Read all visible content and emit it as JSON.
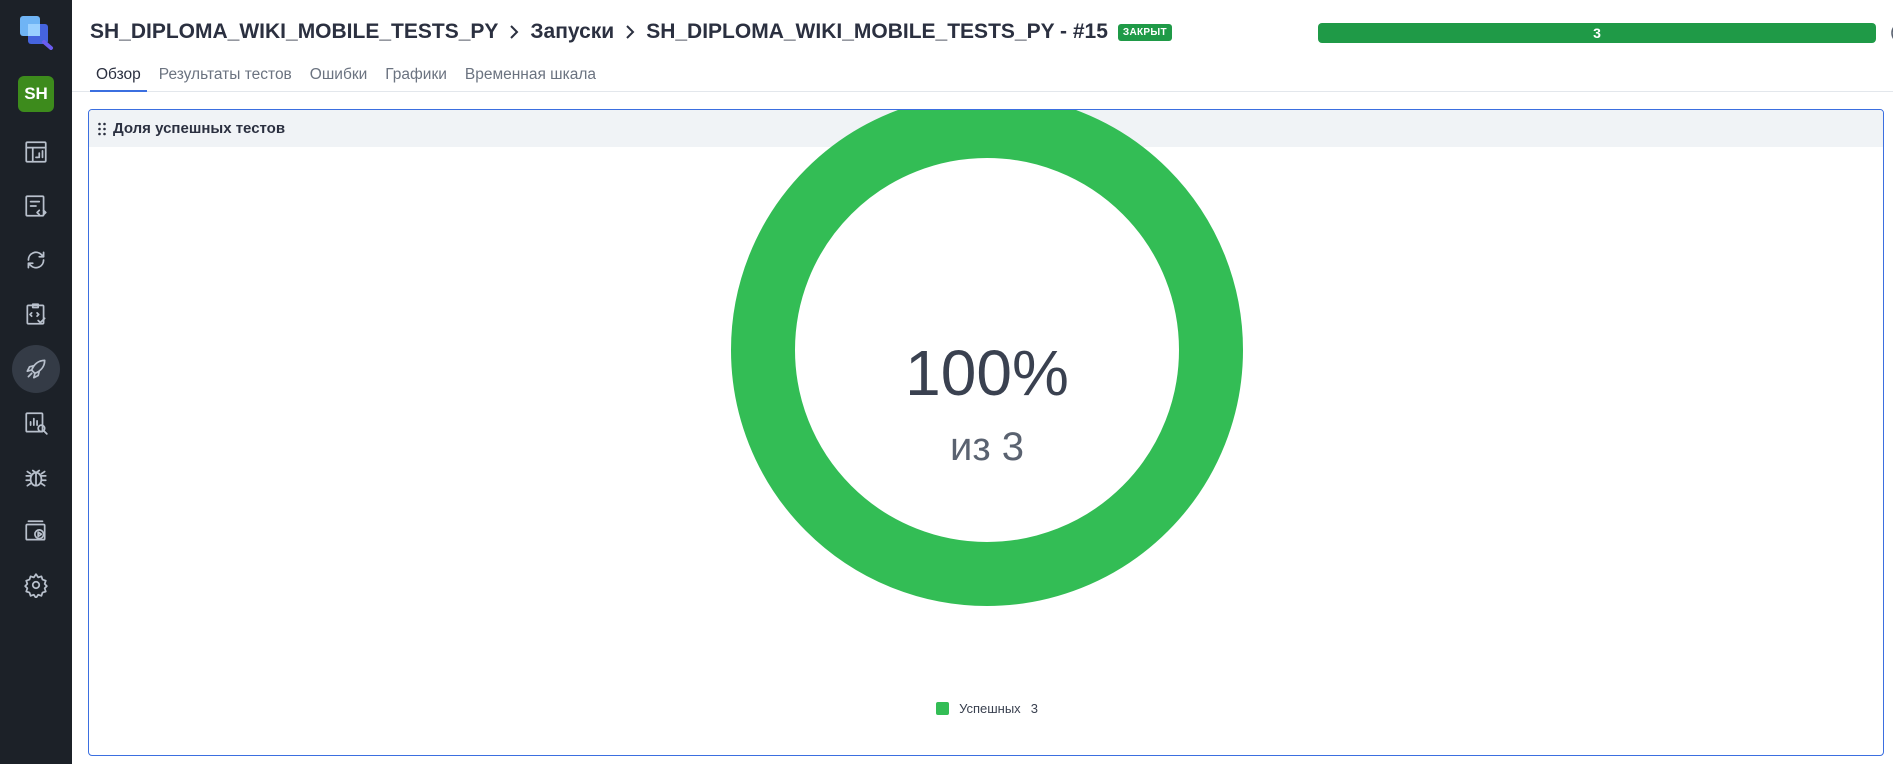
{
  "app": {
    "avatar_initials": "SH"
  },
  "sidebar": {
    "items": [
      {
        "icon": "dashboard-icon"
      },
      {
        "icon": "test-cases-icon"
      },
      {
        "icon": "sync-icon"
      },
      {
        "icon": "test-plans-icon"
      },
      {
        "icon": "launches-icon",
        "active": true
      },
      {
        "icon": "analytics-icon"
      },
      {
        "icon": "bug-icon"
      },
      {
        "icon": "jobs-icon"
      },
      {
        "icon": "gear-icon"
      }
    ]
  },
  "header": {
    "breadcrumb": {
      "project": "SH_DIPLOMA_WIKI_MOBILE_TESTS_PY",
      "section": "Запуски",
      "launch": "SH_DIPLOMA_WIKI_MOBILE_TESTS_PY - #15"
    },
    "status_badge": "ЗАКРЫТ",
    "progress_label": "3",
    "progress_fraction": 1.0
  },
  "tabs": [
    {
      "label": "Обзор",
      "active": true
    },
    {
      "label": "Результаты тестов"
    },
    {
      "label": "Ошибки"
    },
    {
      "label": "Графики"
    },
    {
      "label": "Временная шкала"
    }
  ],
  "widget": {
    "title": "Доля успешных тестов",
    "center_percent": "100%",
    "center_total": "из 3"
  },
  "chart_data": {
    "type": "pie",
    "categories": [
      "Успешных"
    ],
    "values": [
      3
    ],
    "legend": [
      {
        "name": "Успешных",
        "count": "3",
        "color": "#33bd55"
      }
    ]
  },
  "colors": {
    "accent": "#3b6fe0",
    "success": "#33bd55",
    "status_green": "#1f9a47",
    "sidebar_bg": "#1c2128"
  }
}
